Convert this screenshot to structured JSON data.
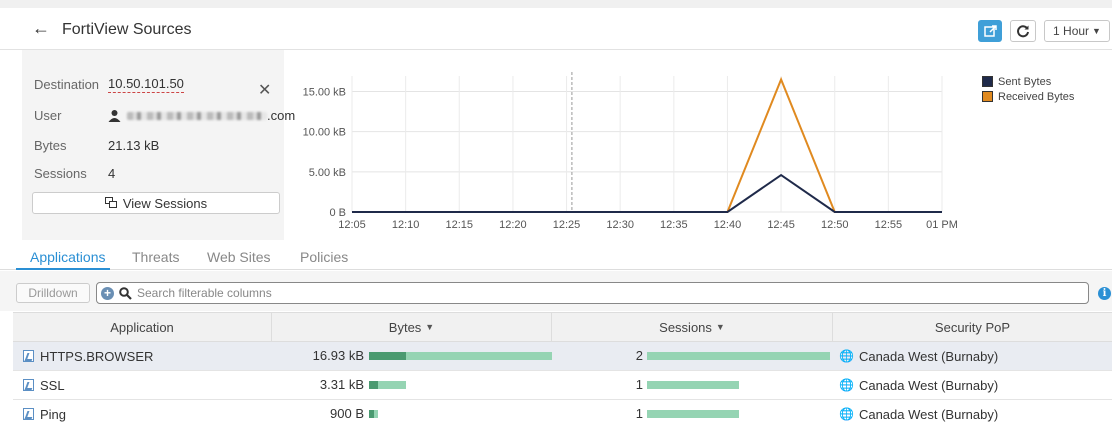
{
  "header": {
    "title": "FortiView Sources",
    "time_range": "1 Hour"
  },
  "summary": {
    "destination_label": "Destination",
    "destination_value": "10.50.101.50",
    "user_label": "User",
    "user_value_suffix": ".com",
    "bytes_label": "Bytes",
    "bytes_value": "21.13 kB",
    "sessions_label": "Sessions",
    "sessions_value": "4",
    "view_sessions_label": "View Sessions"
  },
  "chart_data": {
    "type": "line",
    "x": [
      "12:05",
      "12:10",
      "12:15",
      "12:20",
      "12:25",
      "12:30",
      "12:35",
      "12:40",
      "12:45",
      "12:50",
      "12:55",
      "01 PM"
    ],
    "x_labels": [
      "12:05",
      "12:10",
      "12:15",
      "12:20",
      "12:25",
      "12:30",
      "12:35",
      "12:40",
      "12:45",
      "12:50",
      "12:55",
      "01 PM"
    ],
    "y_ticks": [
      "0 B",
      "5.00 kB",
      "10.00 kB",
      "15.00 kB"
    ],
    "ylim": [
      0,
      16.93
    ],
    "series": [
      {
        "name": "Sent Bytes",
        "color": "#1f2a4a",
        "values": [
          0,
          0,
          0,
          0,
          0,
          0,
          0,
          0,
          4.6,
          0,
          0,
          0
        ]
      },
      {
        "name": "Received Bytes",
        "color": "#e08a20",
        "values": [
          0,
          0,
          0,
          0,
          0,
          0,
          0,
          0,
          16.5,
          0,
          0,
          0
        ]
      }
    ],
    "legend_position": "top-right",
    "grid": true
  },
  "tabs": [
    "Applications",
    "Threats",
    "Web Sites",
    "Policies"
  ],
  "toolbar": {
    "drilldown_label": "Drilldown",
    "search_placeholder": "Search filterable columns"
  },
  "table": {
    "headers": [
      "Application",
      "Bytes",
      "Sessions",
      "Security PoP"
    ],
    "rows": [
      {
        "app": "HTTPS.BROWSER",
        "bytes": "16.93 kB",
        "bytes_frac": 1.0,
        "bytes_dark_frac": 0.2,
        "sessions": "2",
        "sessions_frac": 1.0,
        "pop": "Canada West (Burnaby)"
      },
      {
        "app": "SSL",
        "bytes": "3.31 kB",
        "bytes_frac": 0.2,
        "bytes_dark_frac": 0.25,
        "sessions": "1",
        "sessions_frac": 0.5,
        "pop": "Canada West (Burnaby)"
      },
      {
        "app": "Ping",
        "bytes": "900 B",
        "bytes_frac": 0.05,
        "bytes_dark_frac": 0.5,
        "sessions": "1",
        "sessions_frac": 0.5,
        "pop": "Canada West (Burnaby)"
      }
    ]
  }
}
